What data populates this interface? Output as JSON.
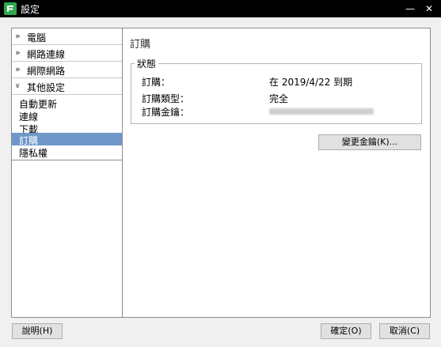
{
  "window": {
    "title": "設定",
    "minimize_glyph": "—",
    "close_glyph": "✕"
  },
  "nav": {
    "items": [
      {
        "label": "電腦",
        "chevron": "»"
      },
      {
        "label": "網路連線",
        "chevron": "»"
      },
      {
        "label": "網際網路",
        "chevron": "»"
      },
      {
        "label": "其他設定",
        "chevron": "»",
        "expanded": true
      }
    ],
    "sub_items": [
      {
        "label": "自動更新"
      },
      {
        "label": "連線"
      },
      {
        "label": "下載"
      },
      {
        "label": "訂購",
        "selected": true
      },
      {
        "label": "隱私權"
      }
    ]
  },
  "main": {
    "title": "訂購",
    "status": {
      "legend": "狀態",
      "rows": [
        {
          "label": "訂購：",
          "value": "在 2019/4/22 到期"
        },
        {
          "label": "訂購類型：",
          "value": "完全"
        },
        {
          "label": "訂購金鑰：",
          "value": ""
        }
      ]
    },
    "change_key_label": "變更金鑰(K)..."
  },
  "footer": {
    "help_label": "說明(H)",
    "ok_label": "確定(O)",
    "cancel_label": "取消(C)"
  },
  "colors": {
    "accent_selected": "#6f97c9",
    "titlebar": "#000000",
    "app_icon": "#2fa84f"
  }
}
